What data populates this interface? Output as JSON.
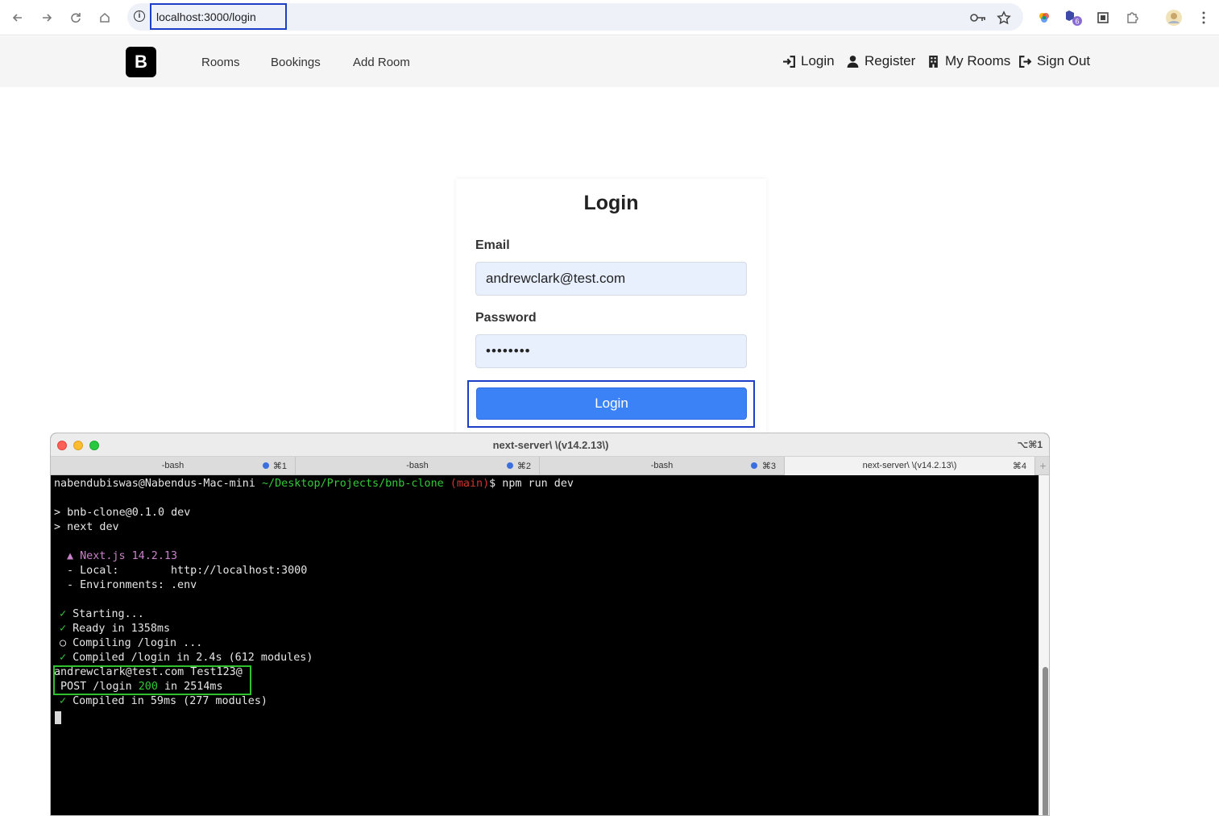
{
  "browser": {
    "url": "localhost:3000/login"
  },
  "navbar": {
    "brand": "B",
    "links": [
      "Rooms",
      "Bookings",
      "Add Room"
    ],
    "right_links": [
      "Login",
      "Register",
      "My Rooms",
      "Sign Out"
    ]
  },
  "login": {
    "title": "Login",
    "email_label": "Email",
    "email_value": "andrewclark@test.com",
    "password_label": "Password",
    "password_value": "••••••••",
    "button_label": "Login"
  },
  "terminal": {
    "title": "next-server\\ \\(v14.2.13\\)",
    "shortcut": "⌥⌘1",
    "tabs": [
      {
        "name": "-bash",
        "key": "⌘1"
      },
      {
        "name": "-bash",
        "key": "⌘2"
      },
      {
        "name": "-bash",
        "key": "⌘3"
      },
      {
        "name": "next-server\\ \\(v14.2.13\\)",
        "key": "⌘4"
      }
    ],
    "prompt_user": "nabendubiswas@Nabendus-Mac-mini",
    "prompt_path": "~/Desktop/Projects/bnb-clone",
    "prompt_branch": "(main)",
    "prompt_cmd": "$ npm run dev",
    "l_script1": "> bnb-clone@0.1.0 dev",
    "l_script2": "> next dev",
    "l_nextjs": "▲ Next.js 14.2.13",
    "l_local_label": "- Local:",
    "l_local_url": "http://localhost:3000",
    "l_env": "- Environments: .env",
    "l_starting": "Starting...",
    "l_ready": "Ready in 1358ms",
    "l_compiling": "Compiling /login ...",
    "l_compiled1": "Compiled /login in 2.4s (612 modules)",
    "l_creds": "andrewclark@test.com Test123@",
    "l_post_a": "POST /login",
    "l_post_code": "200",
    "l_post_b": "in 2514ms",
    "l_compiled2": "Compiled in 59ms (277 modules)",
    "check": "✓",
    "circle": "○"
  }
}
